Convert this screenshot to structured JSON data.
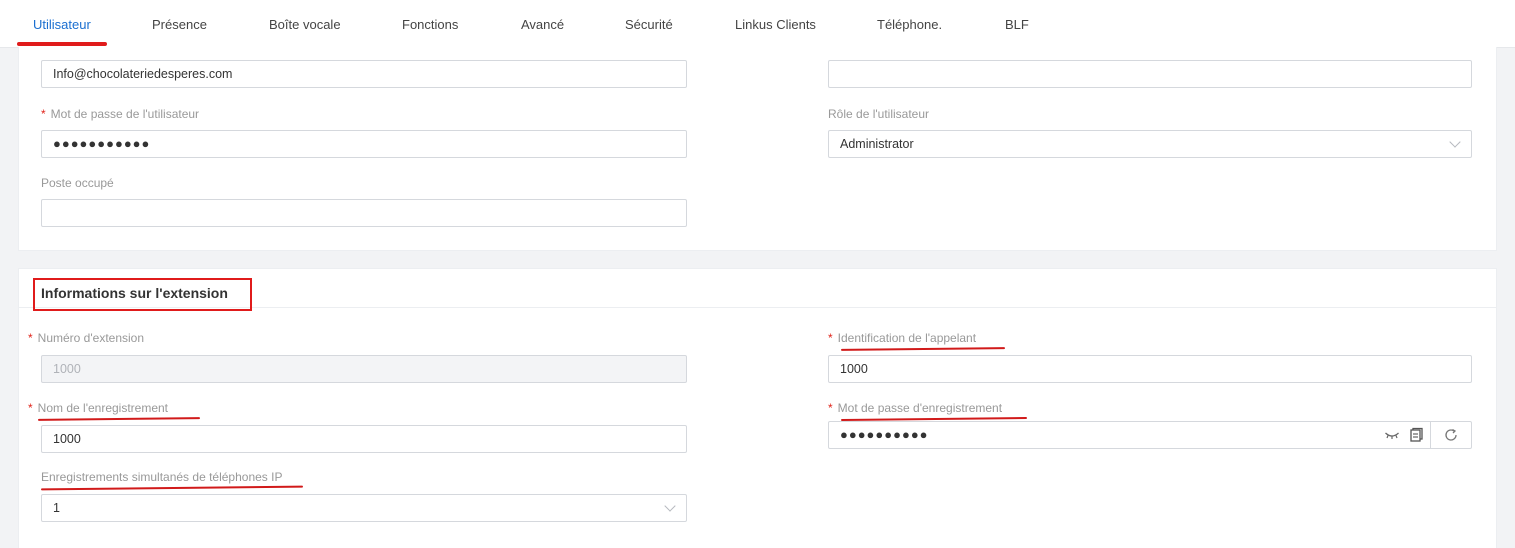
{
  "tabs": [
    {
      "label": "Utilisateur",
      "active": true
    },
    {
      "label": "Présence"
    },
    {
      "label": "Boîte vocale"
    },
    {
      "label": "Fonctions"
    },
    {
      "label": "Avancé"
    },
    {
      "label": "Sécurité"
    },
    {
      "label": "Linkus Clients"
    },
    {
      "label": "Téléphone."
    },
    {
      "label": "BLF"
    }
  ],
  "user_section": {
    "email_value": "Info@chocolateriedesperes.com",
    "right_field_value": "",
    "password_label": "Mot de passe de l'utilisateur",
    "password_value": "●●●●●●●●●●●",
    "role_label": "Rôle de l'utilisateur",
    "role_value": "Administrator",
    "position_label": "Poste occupé",
    "position_value": ""
  },
  "extension_section": {
    "title": "Informations sur l'extension",
    "ext_number_label": "Numéro d'extension",
    "ext_number_value": "1000",
    "caller_id_label": "Identification de l'appelant",
    "caller_id_value": "1000",
    "reg_name_label": "Nom de l'enregistrement",
    "reg_name_value": "1000",
    "reg_password_label": "Mot de passe d'enregistrement",
    "reg_password_value": "●●●●●●●●●●",
    "concurrent_label": "Enregistrements simultanés de téléphones IP",
    "concurrent_value": "1"
  },
  "required_mark": "*",
  "colors": {
    "accent": "#1b6fd0",
    "annotation": "#e01b1b"
  }
}
